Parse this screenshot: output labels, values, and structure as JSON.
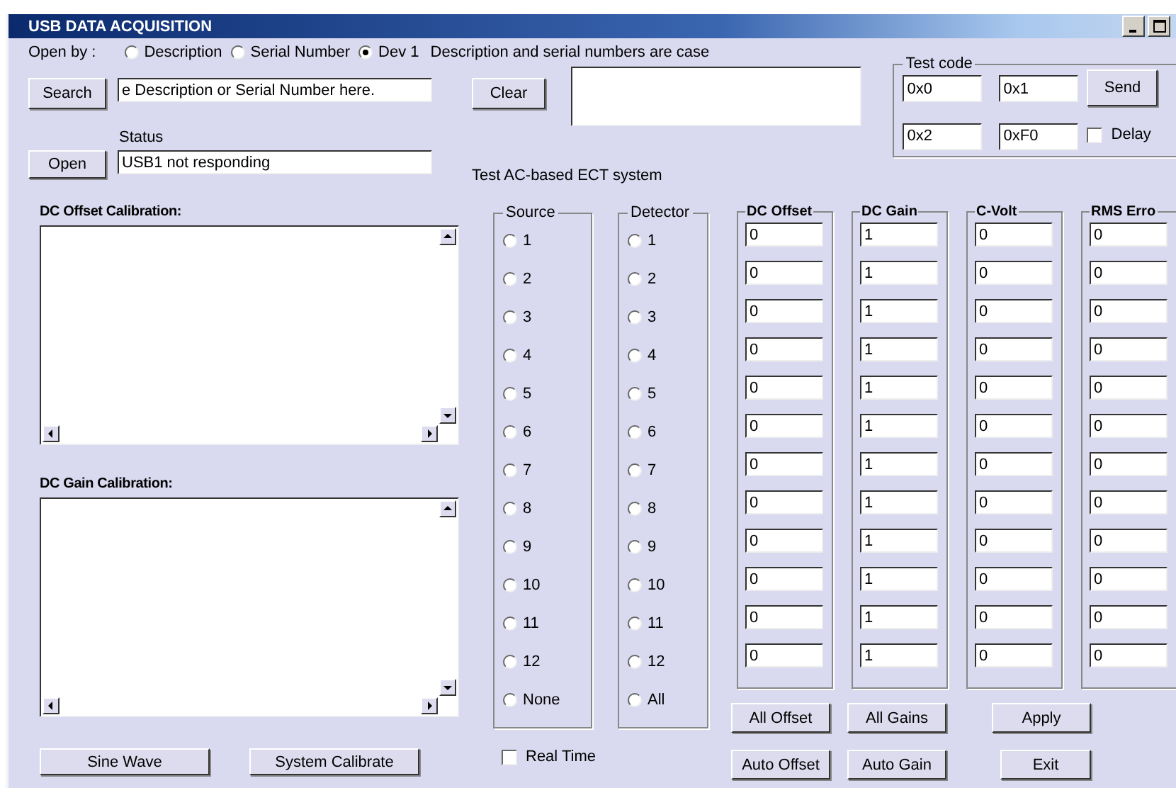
{
  "window": {
    "title": "USB DATA ACQUISITION"
  },
  "open_by": {
    "label": "Open by :",
    "options": [
      {
        "label": "Description",
        "selected": false
      },
      {
        "label": "Serial Number",
        "selected": false
      },
      {
        "label": "Dev 1",
        "selected": true
      }
    ],
    "note": "Description and serial numbers are case"
  },
  "search_button": "Search",
  "search_field": {
    "value": "e Description or Serial Number here."
  },
  "clear_button": "Clear",
  "status": {
    "label": "Status",
    "value": "USB1 not responding"
  },
  "open_button": "Open",
  "test_label": "Test AC-based ECT system",
  "test_code": {
    "title": "Test code",
    "fields": [
      "0x0",
      "0x1",
      "0x2",
      "0xF0"
    ],
    "send_button": "Send",
    "delay": {
      "label": "Delay",
      "checked": false
    }
  },
  "dc_offset_calibration": {
    "label": "DC Offset Calibration:"
  },
  "dc_gain_calibration": {
    "label": "DC Gain Calibration:"
  },
  "source": {
    "title": "Source",
    "options": [
      {
        "label": "1",
        "selected": false
      },
      {
        "label": "2",
        "selected": false
      },
      {
        "label": "3",
        "selected": false
      },
      {
        "label": "4",
        "selected": false
      },
      {
        "label": "5",
        "selected": false
      },
      {
        "label": "6",
        "selected": false
      },
      {
        "label": "7",
        "selected": false
      },
      {
        "label": "8",
        "selected": false
      },
      {
        "label": "9",
        "selected": false
      },
      {
        "label": "10",
        "selected": false
      },
      {
        "label": "11",
        "selected": false
      },
      {
        "label": "12",
        "selected": false
      },
      {
        "label": "None",
        "selected": false
      }
    ]
  },
  "detector": {
    "title": "Detector",
    "options": [
      {
        "label": "1",
        "selected": false
      },
      {
        "label": "2",
        "selected": false
      },
      {
        "label": "3",
        "selected": false
      },
      {
        "label": "4",
        "selected": false
      },
      {
        "label": "5",
        "selected": false
      },
      {
        "label": "6",
        "selected": false
      },
      {
        "label": "7",
        "selected": false
      },
      {
        "label": "8",
        "selected": false
      },
      {
        "label": "9",
        "selected": false
      },
      {
        "label": "10",
        "selected": false
      },
      {
        "label": "11",
        "selected": false
      },
      {
        "label": "12",
        "selected": false
      },
      {
        "label": "All",
        "selected": false
      }
    ]
  },
  "columns": [
    {
      "title": "DC Offset",
      "values": [
        "0",
        "0",
        "0",
        "0",
        "0",
        "0",
        "0",
        "0",
        "0",
        "0",
        "0",
        "0"
      ]
    },
    {
      "title": "DC Gain",
      "values": [
        "1",
        "1",
        "1",
        "1",
        "1",
        "1",
        "1",
        "1",
        "1",
        "1",
        "1",
        "1"
      ]
    },
    {
      "title": "C-Volt",
      "values": [
        "0",
        "0",
        "0",
        "0",
        "0",
        "0",
        "0",
        "0",
        "0",
        "0",
        "0",
        "0"
      ]
    },
    {
      "title": "RMS Erro",
      "values": [
        "0",
        "0",
        "0",
        "0",
        "0",
        "0",
        "0",
        "0",
        "0",
        "0",
        "0",
        "0"
      ]
    }
  ],
  "real_time": {
    "label": "Real Time",
    "checked": false
  },
  "buttons": {
    "sine_wave": "Sine Wave",
    "system_calibrate": "System Calibrate",
    "all_offset": "All Offset",
    "all_gains": "All Gains",
    "apply": "Apply",
    "auto_offset": "Auto Offset",
    "auto_gain": "Auto Gain",
    "exit": "Exit"
  }
}
